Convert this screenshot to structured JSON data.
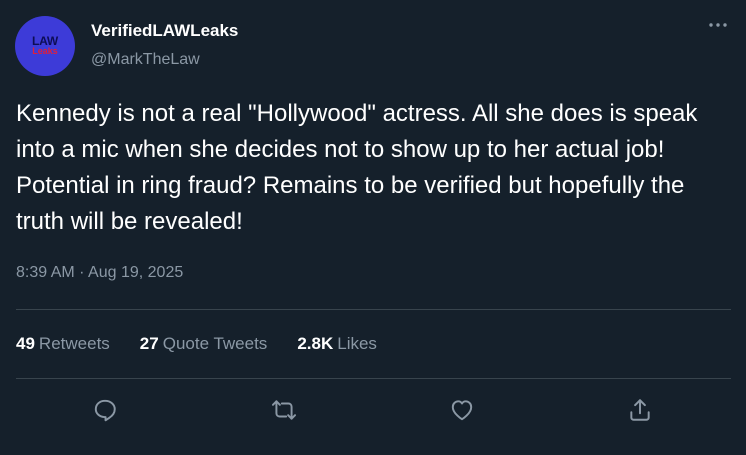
{
  "author": {
    "display_name": "VerifiedLAWLeaks",
    "handle": "@MarkTheLaw",
    "avatar_logo_top": "LAW",
    "avatar_logo_bottom": "Leaks",
    "avatar_color": "#3d3bd8"
  },
  "tweet": {
    "text": "Kennedy is not a real \"Hollywood\" actress. All she does is speak into a mic when she decides not to show up to her actual job! Potential in ring fraud? Remains to be verified but hopefully the truth will be revealed!",
    "timestamp": "8:39 AM · Aug 19, 2025"
  },
  "stats": {
    "retweets_count": "49",
    "retweets_label": "Retweets",
    "quotes_count": "27",
    "quotes_label": "Quote Tweets",
    "likes_count": "2.8K",
    "likes_label": "Likes"
  },
  "icons": {
    "more": "more-options-icon",
    "reply": "reply-icon",
    "retweet": "retweet-icon",
    "like": "like-icon",
    "share": "share-icon"
  },
  "colors": {
    "background": "#15202b",
    "text_primary": "#ffffff",
    "text_secondary": "#8b98a5",
    "divider": "#38444d"
  }
}
